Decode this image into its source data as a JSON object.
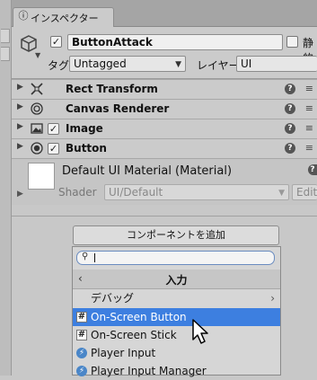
{
  "tab": {
    "label": "インスペクター",
    "icon": "info-icon"
  },
  "header": {
    "object_name": "ButtonAttack",
    "active_checked": true,
    "static_label": "静的",
    "tag_label": "タグ",
    "tag_value": "Untagged",
    "layer_label": "レイヤー",
    "layer_value": "UI"
  },
  "components": [
    {
      "name": "Rect Transform",
      "icon": "rect-transform-icon",
      "has_checkbox": false
    },
    {
      "name": "Canvas Renderer",
      "icon": "canvas-renderer-icon",
      "has_checkbox": false
    },
    {
      "name": "Image",
      "icon": "image-icon",
      "has_checkbox": true
    },
    {
      "name": "Button",
      "icon": "button-icon",
      "has_checkbox": true
    }
  ],
  "material": {
    "name": "Default UI Material (Material)",
    "shader_label": "Shader",
    "shader_value": "UI/Default",
    "edit_label": "Edit..."
  },
  "add_component": {
    "label": "コンポーネントを追加"
  },
  "popup": {
    "search_value": "",
    "title": "入力",
    "items": [
      {
        "label": "デバッグ",
        "icon": "",
        "submenu": true,
        "selected": false
      },
      {
        "label": "On-Screen Button",
        "icon": "script-icon",
        "submenu": false,
        "selected": true
      },
      {
        "label": "On-Screen Stick",
        "icon": "script-icon",
        "submenu": false,
        "selected": false
      },
      {
        "label": "Player Input",
        "icon": "player-input-icon",
        "submenu": false,
        "selected": false
      },
      {
        "label": "Player Input Manager",
        "icon": "player-input-icon",
        "submenu": false,
        "selected": false
      }
    ]
  },
  "colors": {
    "selection": "#3d7fe0",
    "panel": "#cbcbcb"
  }
}
